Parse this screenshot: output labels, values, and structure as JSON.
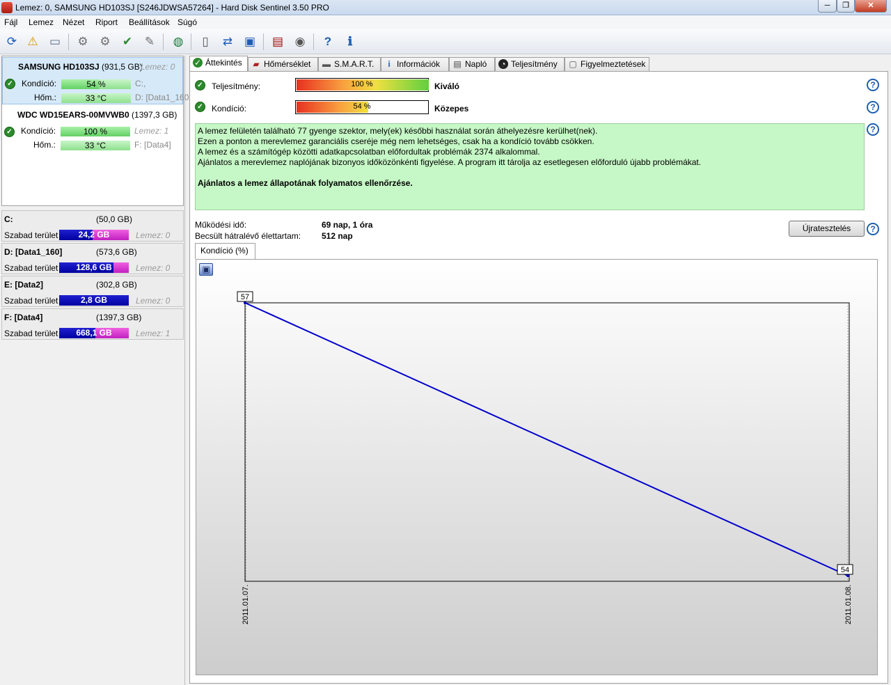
{
  "window": {
    "title": "Lemez: 0, SAMSUNG HD103SJ [S246JDWSA57264]  -  Hard Disk Sentinel 3.50 PRO",
    "minimize": "─",
    "maximize": "❐",
    "close": "✕"
  },
  "menu": [
    "Fájl",
    "Lemez",
    "Nézet",
    "Riport",
    "Beállítások",
    "Súgó"
  ],
  "toolbar_icons": [
    "refresh-icon",
    "alert-icon",
    "disk-icon",
    "disk-test-icon",
    "disk-test2-icon",
    "disk-check-icon",
    "disk-tool-icon",
    "globe-icon",
    "document-icon",
    "sync-icon",
    "network-icon",
    "monitor-icon",
    "sound-icon",
    "help-icon",
    "info-icon"
  ],
  "disks": [
    {
      "name": "SAMSUNG HD103SJ",
      "size": "(931,5 GB)",
      "lemez": "Lemez: 0",
      "condition_label": "Kondíció:",
      "condition_value": "54 %",
      "condition_pct": 54,
      "temp_label": "Hőm.:",
      "temp_value": "33 °C",
      "drive1": "C:,",
      "drive2": "D: [Data1_160"
    },
    {
      "name": "WDC WD15EARS-00MVWB0",
      "size": "(1397,3 GB)",
      "lemez": "Lemez: 1",
      "condition_label": "Kondíció:",
      "condition_value": "100 %",
      "condition_pct": 100,
      "temp_label": "Hőm.:",
      "temp_value": "33 °C",
      "drive1": "F: [Data4]"
    }
  ],
  "partitions": [
    {
      "name": "C:",
      "size": "(50,0 GB)",
      "label": "Szabad terület",
      "free": "24,2 GB",
      "free_fraction": 0.484,
      "lemez": "Lemez: 0"
    },
    {
      "name": "D: [Data1_160]",
      "size": "(573,6 GB)",
      "label": "Szabad terület",
      "free": "128,6 GB",
      "free_fraction": 0.78,
      "lemez": "Lemez: 0"
    },
    {
      "name": "E: [Data2]",
      "size": "(302,8 GB)",
      "label": "Szabad terület",
      "free": "2,8 GB",
      "free_fraction": 1.0,
      "lemez": "Lemez: 0"
    },
    {
      "name": "F: [Data4]",
      "size": "(1397,3 GB)",
      "label": "Szabad terület",
      "free": "668,1 GB",
      "free_fraction": 0.52,
      "lemez": "Lemez: 1"
    }
  ],
  "tabs": [
    "Áttekintés",
    "Hőmérséklet",
    "S.M.A.R.T.",
    "Információk",
    "Napló",
    "Teljesítmény",
    "Figyelmeztetések"
  ],
  "overview": {
    "performance_label": "Teljesítmény:",
    "performance_value": "100 %",
    "performance_pct": 100,
    "performance_rating": "Kiváló",
    "condition_label": "Kondíció:",
    "condition_value": "54 %",
    "condition_pct": 54,
    "condition_rating": "Közepes",
    "message_lines": [
      "A lemez felületén található 77 gyenge szektor, mely(ek) későbbi használat során áthelyezésre kerülhet(nek).",
      "Ezen a ponton a merevlemez garanciális cseréje még nem lehetséges, csak ha a kondíció tovább csökken.",
      "A lemez és a számítógép közötti adatkapcsolatban előfordultak problémák 2374 alkalommal.",
      "Ajánlatos a merevlemez naplójának bizonyos időközönkénti figyelése. A program itt tárolja az esetlegesen előforduló újabb problémákat."
    ],
    "message_bold": "Ajánlatos a lemez állapotának folyamatos ellenőrzése.",
    "uptime_label": "Működési idő:",
    "uptime_value": "69 nap, 1 óra",
    "lifetime_label": "Becsült hátralévő élettartam:",
    "lifetime_value": "512 nap",
    "retest_button": "Újratesztelés",
    "subtab": "Kondíció  (%)"
  },
  "chart_data": {
    "type": "line",
    "title": "Kondíció  (%)",
    "x": [
      "2011.01.07.",
      "2011.01.08."
    ],
    "series": [
      {
        "values": [
          57,
          54
        ]
      }
    ],
    "point_labels": [
      "57",
      "54"
    ],
    "line_color": "#0000cc"
  }
}
